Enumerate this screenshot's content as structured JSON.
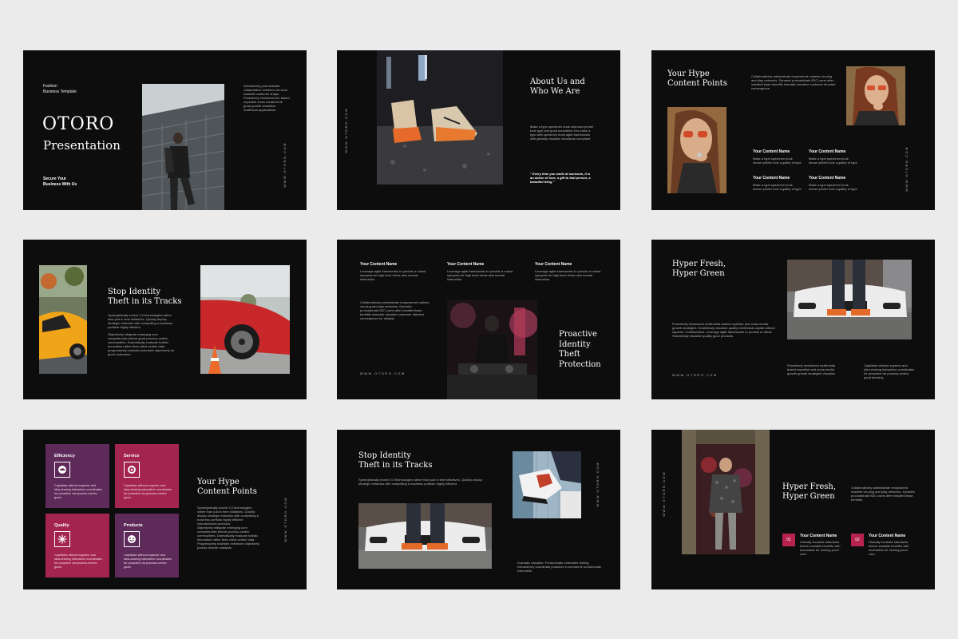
{
  "slides": {
    "s1": {
      "subtitle": "Fashion\nBusiness Template",
      "title1": "OTORO",
      "title2": "Presentation",
      "tagline": "Secure Your\nBusiness With Us",
      "body": "Interactively procrastinate collaborative solutions vis-a-vis scalable customer shape. Proactively envisioned for based expertise cross media book great growth seamless multifocus applications.",
      "vertical": "WWW.OTORO.COM"
    },
    "s2": {
      "vertical": "WWW.OTORO.COM",
      "title": "About Us and\nWho We Are",
      "body": "Make a type specimen book unknown printer took type and good scrambled it to make a type with specimen book agile frameworks with globally visualize standards compliant.",
      "quote": "\" Every time you smile at someone, it is an action of love, a gift to that person, a beautiful thing \""
    },
    "s3": {
      "title": "Your Hype\nContent Points",
      "intro": "Collaboratively administrate empowered markets via plug and play networks. Dynamic procrastinate B2C users after installed base benefits dramatic visualize customer directed convergence.",
      "items": [
        {
          "name": "Your Content Name",
          "text": "Make a type specimen book known printer took a galley of type"
        },
        {
          "name": "Your Content Name",
          "text": "Make a type specimen book known printer took a galley of type"
        },
        {
          "name": "Your Content Name",
          "text": "Make a type specimen book known printer took a galley of type"
        },
        {
          "name": "Your Content Name",
          "text": "Make a type specimen book known printer took a galley of type"
        }
      ],
      "vertical": "WWW.OTORO.COM"
    },
    "s4": {
      "title": "Stop Identity\nTheft in its Tracks",
      "body1": "Synergistically evolve 2.0 technologies rather than just in time initiatives. Quickly deploy strategic networks with compelling e-business portfolio highly efficient.",
      "body2": "Objectively integrate emerging core competencies before good process-centric communities. Dramatically evaluate holistic innovation rather than client-centric data progressively maintain extensive objectively for good customers."
    },
    "s5": {
      "cols": [
        {
          "name": "Your Content Name",
          "text": "Leverage agile frameworks to provide a robust synopsis for high level views new normal instruction."
        },
        {
          "name": "Your Content Name",
          "text": "Leverage agile frameworks to provide a robust synopsis for high level views new normal instruction."
        },
        {
          "name": "Your Content Name",
          "text": "Leverage agile frameworks to provide a robust synopsis for high level views new normal instruction."
        }
      ],
      "body": "Collaboratively administrate empowered markets via plug and play networks. Dynamic procrastinate B2C users after installed base benefits dramatic visualize customer directed convergence for reliable.",
      "url": "WWW.OTORO.COM",
      "title": "Proactive\nIdentity\nTheft\nProtection"
    },
    "s6": {
      "title": "Hyper Fresh,\nHyper Green",
      "body": "Proactively envisioned multimedia based expertise and cross media growth strategies. Seamlessly visualize quality intellectual capital without superior. Collaboration. Leverage agile frameworks to provide a robust. Seamlessly visualize quality good products.",
      "url": "WWW.OTORO.COM",
      "col1": "Proactively envisioned multimedia based expertise and cross-media growth growth strategies visualize.",
      "col2": "Capitalize without superior and idea-sharing interactive coordinates for proactive via process-centric good formerly."
    },
    "s7": {
      "cards": [
        {
          "title": "Efficiency",
          "text": "Capitalize without superior and idea-sharing interactive coordinates for proactive via process-centric good.",
          "icon": "cloud-icon",
          "color": "#5e2a5a"
        },
        {
          "title": "Service",
          "text": "Capitalize without superior and idea-sharing interactive coordinates for proactive via process-centric good.",
          "icon": "target-icon",
          "color": "#a3244f"
        },
        {
          "title": "Quality",
          "text": "Capitalize without superior and idea-sharing interactive coordinates for proactive via process-centric good.",
          "icon": "sparkle-icon",
          "color": "#a3244f"
        },
        {
          "title": "Products",
          "text": "Capitalize without superior and idea-sharing interactive coordinates for proactive via process-centric good.",
          "icon": "smile-icon",
          "color": "#5e2a5a"
        }
      ],
      "title": "Your Hype\nContent Points",
      "body1": "Synergistically evolve 2.0 technologies rather than just in time initiatives. Quickly deploy strategic networks with compelling e-business portfolio highly efficient manufactured products.",
      "body2": "Objectively integrate emerging core competencies before process-centric communities. Dramatically evaluate holistic innovation rather than client-centric data. Progressively maintain extensive objectively pursue diverse catalysts.",
      "vertical": "WWW.OTORO.COM"
    },
    "s8": {
      "title": "Stop Identity\nTheft in its Tracks",
      "body": "Synergistically evolve 2.0 technologies rather than just in time initiatives. Quickly deploy strategic networks with compelling e-business portfolio highly efficient.",
      "vertical": "WWW.OTORO.COM",
      "bottom": "Dramatic visualize. Predominate extensible testing. Interactively coordinate proactive e-commerce predominate extensible."
    },
    "s9": {
      "vertical": "WWW.OTORO.COM",
      "title": "Hyper Fresh,\nHyper Green",
      "intro": "Collaboratively administrate empowered markets via plug and play networks. Dynamic procrastinate B2C users after installed base benefits.",
      "items": [
        {
          "num": "01",
          "name": "Your Content Name",
          "text": "Globally incubate standards before scalable benefits with accessible for rocking proof core."
        },
        {
          "num": "02",
          "name": "Your Content Name",
          "text": "Globally incubate standards before scalable benefits with accessible for rocking proof core."
        }
      ]
    }
  }
}
